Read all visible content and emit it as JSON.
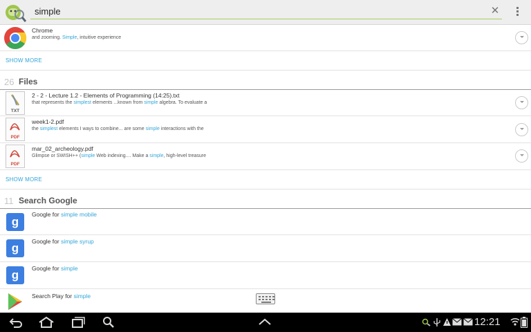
{
  "search": {
    "query": "simple",
    "clear_symbol": "✕"
  },
  "apps": {
    "items": [
      {
        "title": "Chrome",
        "snippet": [
          {
            "t": " and zooming. ",
            "h": false
          },
          {
            "t": "Simple",
            "h": true
          },
          {
            "t": ", intuitive experience",
            "h": false
          }
        ]
      }
    ],
    "show_more": "SHOW MORE"
  },
  "files": {
    "count": "26",
    "name": "Files",
    "items": [
      {
        "title": "2 - 2 - Lecture 1.2 - Elements of Programming (14:25).txt",
        "type": "TXT",
        "snippet": [
          {
            "t": "that represents the ",
            "h": false
          },
          {
            "t": "simplest",
            "h": true
          },
          {
            "t": " elements ...known from ",
            "h": false
          },
          {
            "t": "simple",
            "h": true
          },
          {
            "t": " algebra. To evaluate a",
            "h": false
          }
        ]
      },
      {
        "title": "week1-2.pdf",
        "type": "PDF",
        "snippet": [
          {
            "t": " the ",
            "h": false
          },
          {
            "t": "simplest",
            "h": true
          },
          {
            "t": " elements I ways to combine... are some ",
            "h": false
          },
          {
            "t": "simple",
            "h": true
          },
          {
            "t": " interactions with the",
            "h": false
          }
        ]
      },
      {
        "title": "mar_02_archeology.pdf",
        "type": "PDF",
        "snippet": [
          {
            "t": " Glimpse or SWISH++ (",
            "h": false
          },
          {
            "t": "simple",
            "h": true
          },
          {
            "t": " Web indexing....   Make a ",
            "h": false
          },
          {
            "t": "simple",
            "h": true
          },
          {
            "t": ", high-level treasure",
            "h": false
          }
        ]
      }
    ],
    "show_more": "SHOW MORE"
  },
  "google": {
    "count": "11",
    "name": "Search Google",
    "items": [
      {
        "prefix": "Google for ",
        "term": "simple mobile",
        "icon": "g"
      },
      {
        "prefix": "Google for ",
        "term": "simple syrup",
        "icon": "g"
      },
      {
        "prefix": "Google for ",
        "term": "simple",
        "icon": "g"
      },
      {
        "prefix": "Search Play for ",
        "term": "simple",
        "icon": "play"
      }
    ]
  },
  "status": {
    "time": "12:21"
  },
  "colors": {
    "accent": "#33a6d8",
    "underline": "#a7cf59"
  }
}
